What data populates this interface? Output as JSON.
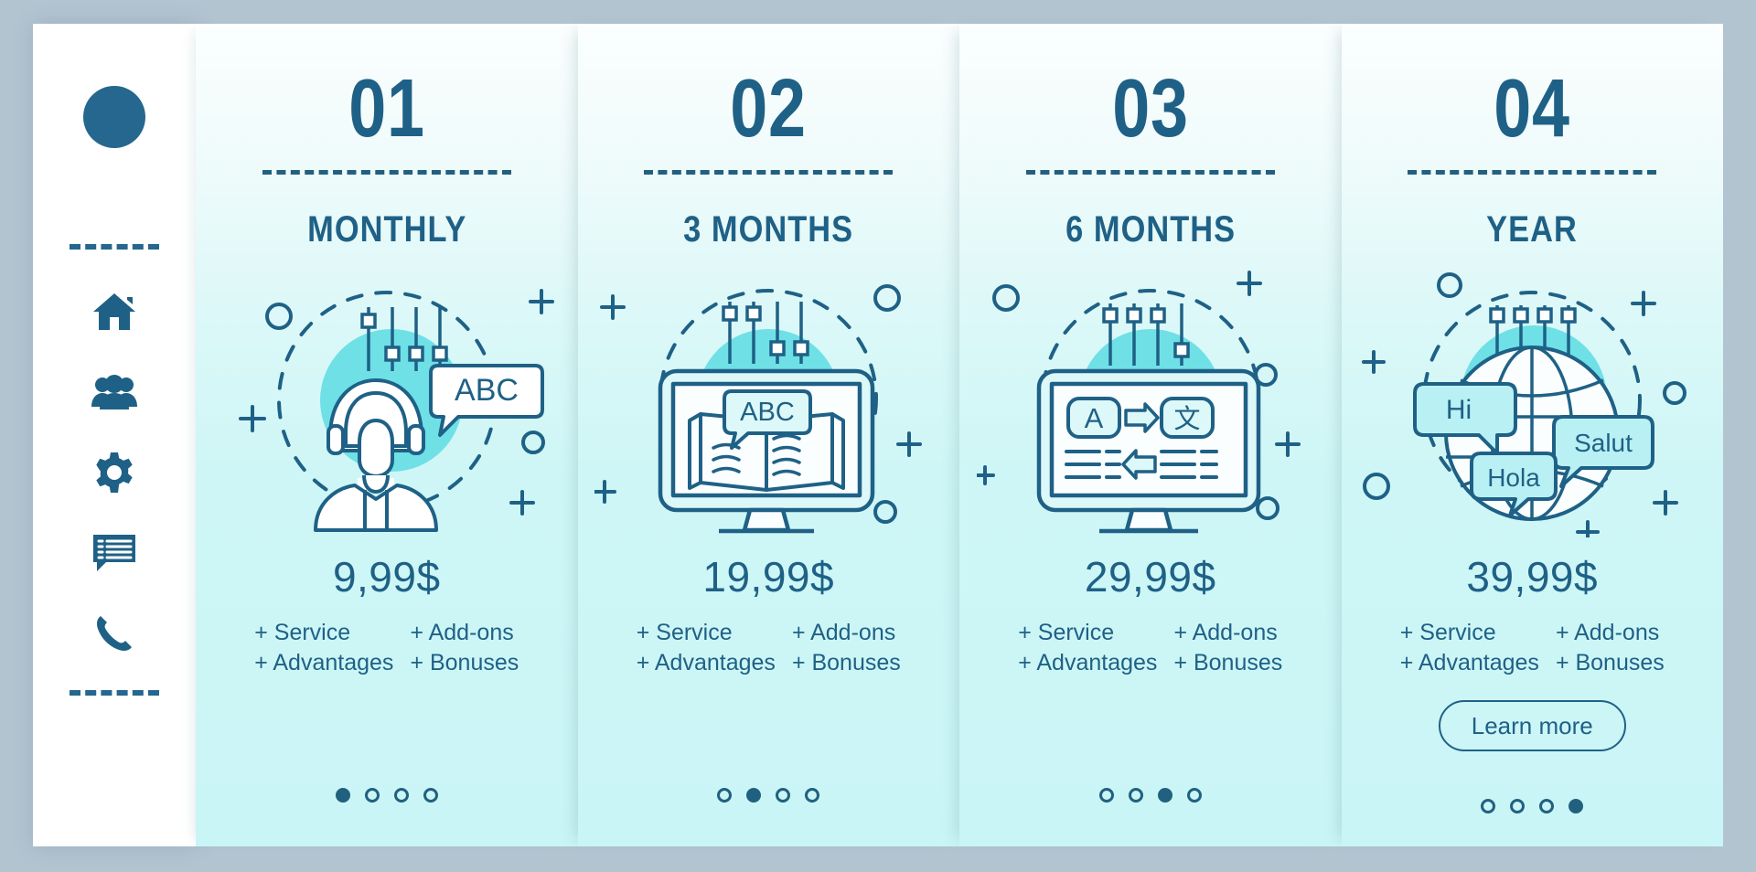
{
  "theme": {
    "page_background": "#b3c4d1",
    "sidebar_background": "#ffffff",
    "accent_dark": "#1f6186",
    "accent_line": "#21607f",
    "accent_cyan": "#6fe0e6",
    "card_gradient_top": "#fbfefe",
    "card_gradient_bottom": "#caf5f6"
  },
  "sidebar": {
    "logo": {
      "name": "logo-circle"
    },
    "divider_top": "dashed-divider",
    "divider_bottom": "dashed-divider",
    "items": [
      {
        "icon": "home-icon",
        "label": "Home"
      },
      {
        "icon": "people-icon",
        "label": "Community"
      },
      {
        "icon": "gear-icon",
        "label": "Settings"
      },
      {
        "icon": "chat-icon",
        "label": "Messages"
      },
      {
        "icon": "phone-icon",
        "label": "Call"
      }
    ]
  },
  "cards": [
    {
      "number": "01",
      "title": "MONTHLY",
      "price": "9,99$",
      "features": [
        "+ Service",
        "+ Add-ons",
        "+ Advantages",
        "+ Bonuses"
      ],
      "illustration": "headset-woman-abc-icon",
      "illustration_text": [
        "ABC"
      ],
      "dots": {
        "count": 4,
        "active": 1
      },
      "has_button": false,
      "button_label": ""
    },
    {
      "number": "02",
      "title": "3 MONTHS",
      "price": "19,99$",
      "features": [
        "+ Service",
        "+ Add-ons",
        "+ Advantages",
        "+ Bonuses"
      ],
      "illustration": "monitor-book-abc-icon",
      "illustration_text": [
        "ABC"
      ],
      "dots": {
        "count": 4,
        "active": 2
      },
      "has_button": false,
      "button_label": ""
    },
    {
      "number": "03",
      "title": "6 MONTHS",
      "price": "29,99$",
      "features": [
        "+ Service",
        "+ Add-ons",
        "+ Advantages",
        "+ Bonuses"
      ],
      "illustration": "monitor-translate-icon",
      "illustration_text": [
        "A",
        "文"
      ],
      "dots": {
        "count": 4,
        "active": 3
      },
      "has_button": false,
      "button_label": ""
    },
    {
      "number": "04",
      "title": "YEAR",
      "price": "39,99$",
      "features": [
        "+ Service",
        "+ Add-ons",
        "+ Advantages",
        "+ Bonuses"
      ],
      "illustration": "globe-greetings-icon",
      "illustration_text": [
        "Hi",
        "Salut",
        "Hola"
      ],
      "dots": {
        "count": 4,
        "active": 4
      },
      "has_button": true,
      "button_label": "Learn more"
    }
  ]
}
